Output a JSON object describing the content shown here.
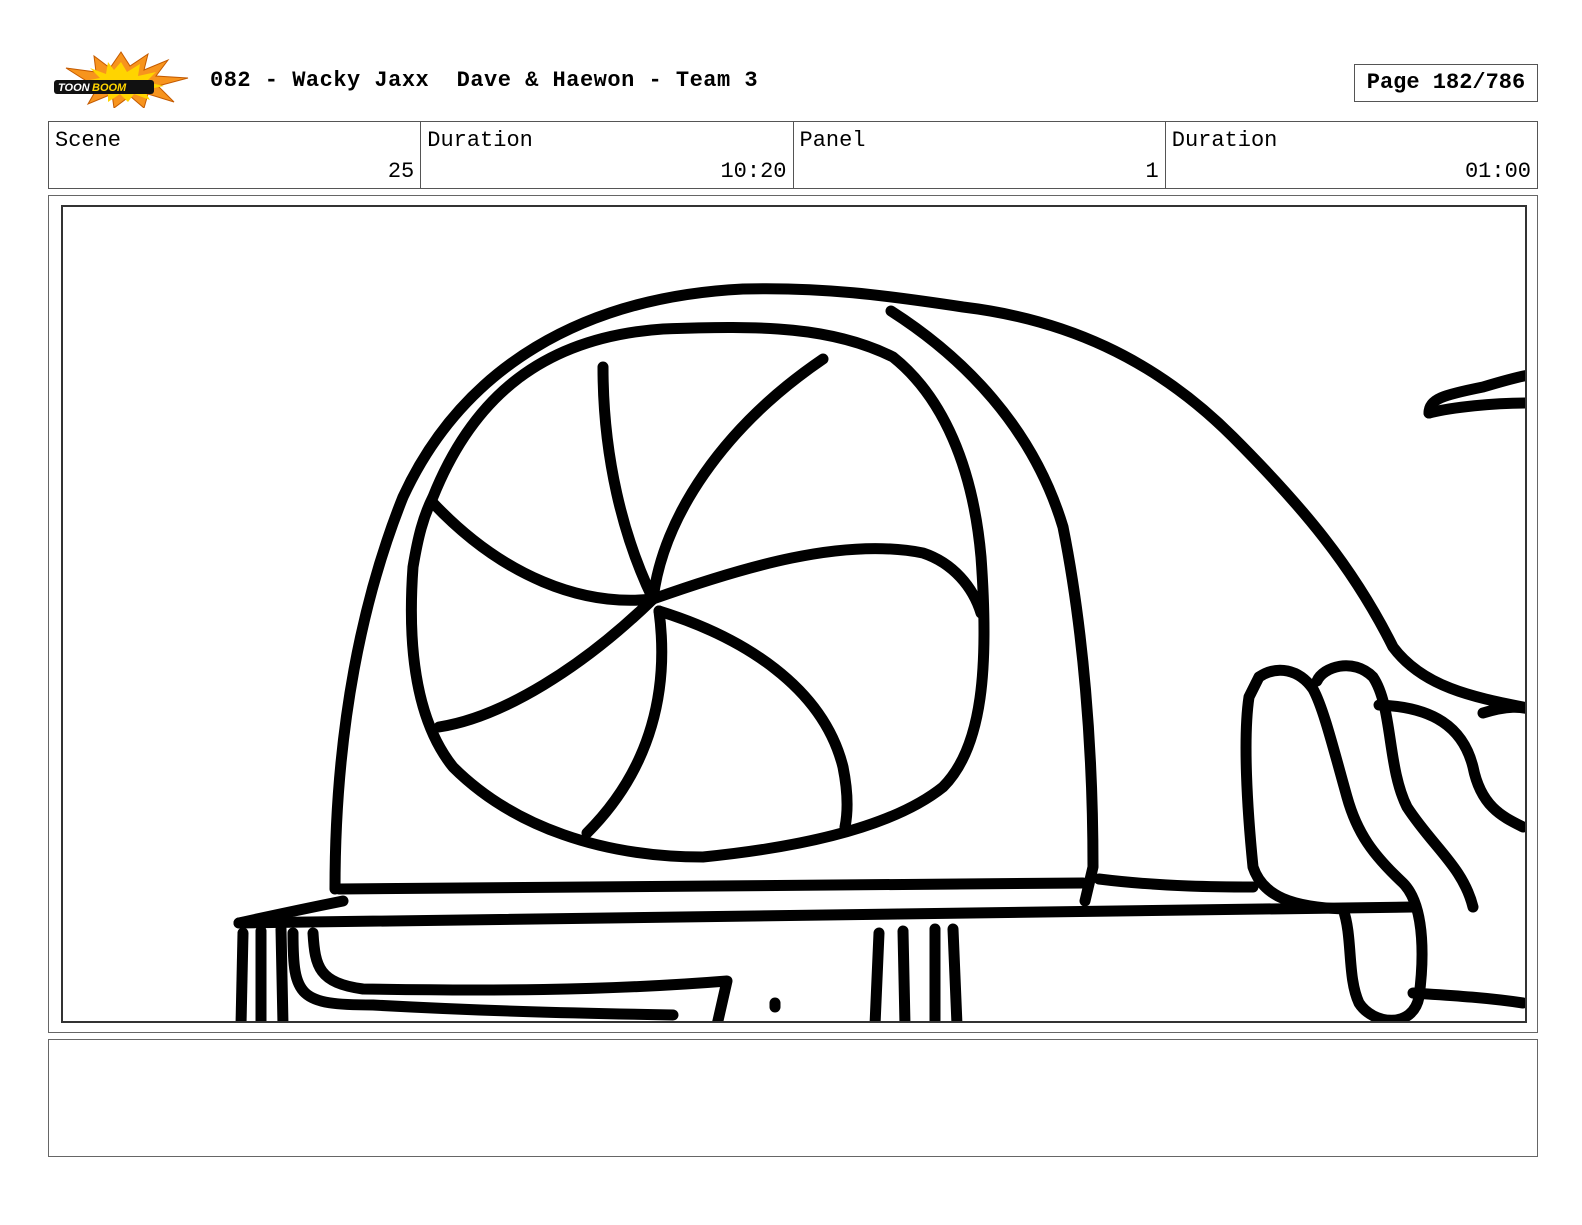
{
  "header": {
    "title": "082 - Wacky Jaxx  Dave & Haewon - Team 3",
    "page": "Page 182/786",
    "logo_icon": "toon-boom-logo-icon"
  },
  "info": {
    "scene_label": "Scene",
    "scene_value": "25",
    "duration_label": "Duration",
    "duration_value": "10:20",
    "panel_label": "Panel",
    "panel_value": "1",
    "panel_duration_label": "Duration",
    "panel_duration_value": "01:00"
  },
  "panel": {
    "drawing_icon": "fan-sketch-icon"
  },
  "notes": {
    "text": ""
  },
  "colors": {
    "logo_orange": "#f7941d",
    "logo_yellow": "#ffd400",
    "ink": "#000000",
    "border": "#555555"
  }
}
